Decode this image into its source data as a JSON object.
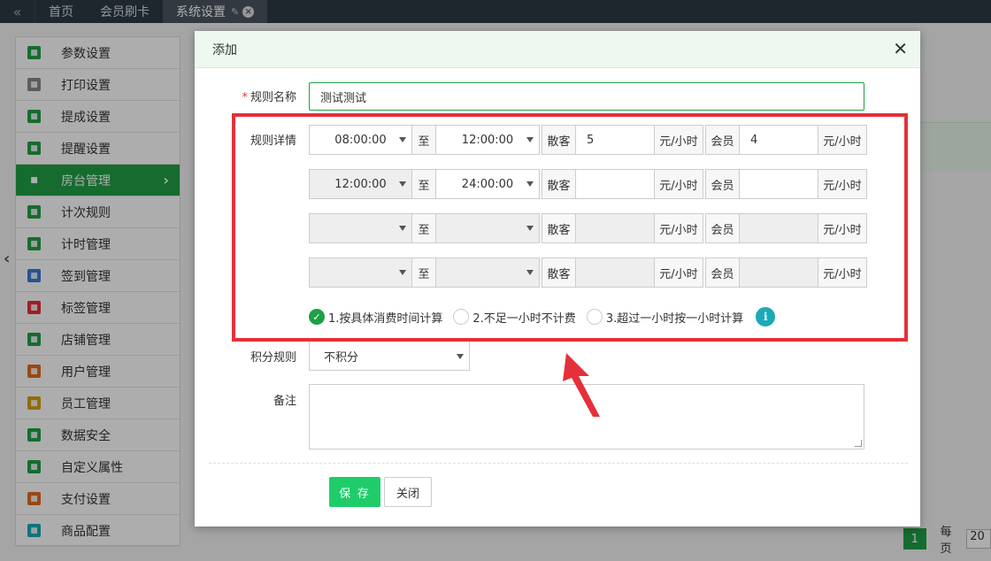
{
  "tabs": [
    {
      "label": "首页"
    },
    {
      "label": "会员刷卡"
    },
    {
      "label": "系统设置"
    }
  ],
  "sidebar": {
    "items": [
      {
        "label": "参数设置",
        "icon": "sliders-icon",
        "color": "#1fa045"
      },
      {
        "label": "打印设置",
        "icon": "printer-icon",
        "color": "#888888"
      },
      {
        "label": "提成设置",
        "icon": "commission-icon",
        "color": "#1fa045"
      },
      {
        "label": "提醒设置",
        "icon": "bell-icon",
        "color": "#1fa045"
      },
      {
        "label": "房台管理",
        "icon": "shield-icon",
        "color": "#1fa045"
      },
      {
        "label": "计次规则",
        "icon": "list-icon",
        "color": "#1fa045"
      },
      {
        "label": "计时管理",
        "icon": "clock-icon",
        "color": "#1fa045"
      },
      {
        "label": "签到管理",
        "icon": "calendar-icon",
        "color": "#3a7bd5"
      },
      {
        "label": "标签管理",
        "icon": "tag-icon",
        "color": "#e5303a"
      },
      {
        "label": "店铺管理",
        "icon": "store-icon",
        "color": "#1fa045"
      },
      {
        "label": "用户管理",
        "icon": "user-icon",
        "color": "#e06b1f"
      },
      {
        "label": "员工管理",
        "icon": "staff-icon",
        "color": "#d4a017"
      },
      {
        "label": "数据安全",
        "icon": "bar-chart-icon",
        "color": "#1fa045"
      },
      {
        "label": "自定义属性",
        "icon": "pencil-icon",
        "color": "#1fa045"
      },
      {
        "label": "支付设置",
        "icon": "payment-icon",
        "color": "#e06b1f"
      },
      {
        "label": "商品配置",
        "icon": "tools-icon",
        "color": "#1aaab8"
      }
    ]
  },
  "pager": {
    "current": "1",
    "per_page_label": "每页",
    "per_page": "20"
  },
  "modal": {
    "title": "添加",
    "name_label": "规则名称",
    "name_value": "测试测试",
    "detail_label": "规则详情",
    "zhi": "至",
    "guest_label": "散客",
    "member_label": "会员",
    "unit": "元/小时",
    "rows": [
      {
        "start": "08:00:00",
        "end": "12:00:00",
        "guest": "5",
        "member": "4"
      },
      {
        "start": "12:00:00",
        "end": "24:00:00",
        "guest": "",
        "member": ""
      },
      {
        "start": "",
        "end": "",
        "guest": "",
        "member": ""
      },
      {
        "start": "",
        "end": "",
        "guest": "",
        "member": ""
      }
    ],
    "options": [
      {
        "label": "1.按具体消费时间计算",
        "checked": true
      },
      {
        "label": "2.不足一小时不计费",
        "checked": false
      },
      {
        "label": "3.超过一小时按一小时计算",
        "checked": false
      }
    ],
    "points_label": "积分规则",
    "points_value": "不积分",
    "remark_label": "备注",
    "save_label": "保 存",
    "close_label": "关闭"
  },
  "colors": {
    "accent": "#1fa045",
    "highlight": "#e5303a",
    "info": "#1aaab8"
  }
}
